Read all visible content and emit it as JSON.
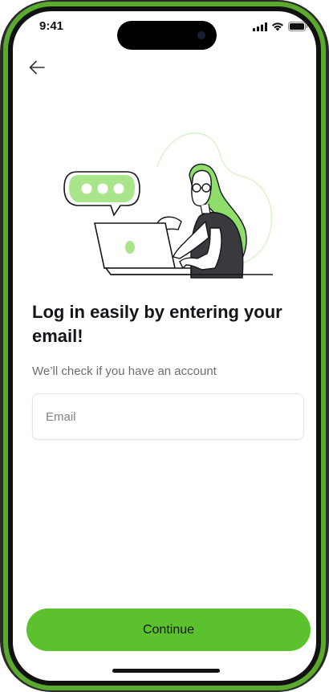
{
  "status_bar": {
    "time": "9:41",
    "icons": [
      "cellular-signal-icon",
      "wifi-icon",
      "battery-icon"
    ]
  },
  "nav": {
    "back_icon": "arrow-left-icon"
  },
  "illustration": {
    "subject": "person-with-laptop-and-chat-bubble",
    "accent_color": "#8fdd6a"
  },
  "content": {
    "heading": "Log in easily by entering your email!",
    "subtitle": "We’ll check if you have an account"
  },
  "form": {
    "email_placeholder": "Email",
    "email_value": ""
  },
  "actions": {
    "continue_label": "Continue"
  },
  "colors": {
    "primary": "#5bc12d",
    "text": "#14151a",
    "muted": "#6b6e75",
    "frame_accent": "#5aaa2d"
  }
}
